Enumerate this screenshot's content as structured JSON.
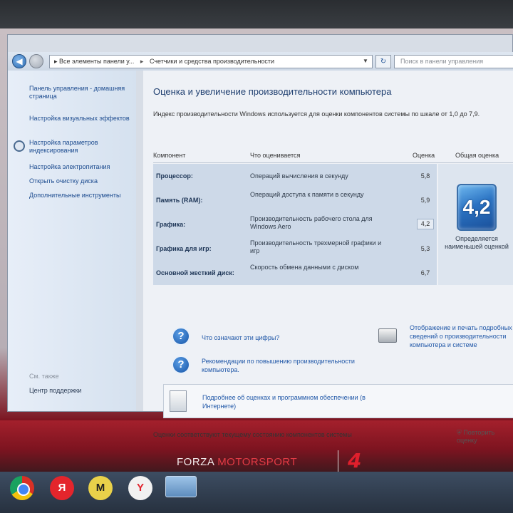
{
  "window": {
    "breadcrumb": [
      "Все элементы панели у...",
      "Счетчики и средства производительности"
    ],
    "search_placeholder": "Поиск в панели управления"
  },
  "sidebar": {
    "links": [
      {
        "label": "Панель управления - домашняя страница"
      },
      {
        "label": "Настройка визуальных эффектов"
      },
      {
        "label": "Настройка параметров индексирования"
      },
      {
        "label": "Настройка электропитания"
      },
      {
        "label": "Открыть очистку диска"
      },
      {
        "label": "Дополнительные инструменты"
      }
    ],
    "see_also": "См. также",
    "support_center": "Центр поддержки"
  },
  "main": {
    "title": "Оценка и увеличение производительности компьютера",
    "description": "Индекс производительности Windows используется для оценки компонентов системы по шкале от 1,0 до 7,9.",
    "table": {
      "headers": {
        "component": "Компонент",
        "what": "Что оценивается",
        "score": "Оценка",
        "overall": "Общая оценка"
      },
      "rows": [
        {
          "component": "Процессор:",
          "what": "Операций вычисления в секунду",
          "score": "5,8"
        },
        {
          "component": "Память (RAM):",
          "what": "Операций доступа к памяти в секунду",
          "score": "5,9"
        },
        {
          "component": "Графика:",
          "what": "Производительность рабочего стола для Windows Aero",
          "score": "4,2"
        },
        {
          "component": "Графика для игр:",
          "what": "Производительность трехмерной графики и игр",
          "score": "5,3"
        },
        {
          "component": "Основной жесткий диск:",
          "what": "Скорость обмена данными с диском",
          "score": "6,7"
        }
      ],
      "overall_score": "4,2",
      "overall_note": "Определяется наименьшей оценкой"
    },
    "links": {
      "what_numbers": "Что означают эти цифры?",
      "recommendations": "Рекомендации по повышению производительности компьютера.",
      "print_details": "Отображение и печать подробных сведений о производительности компьютера и системе",
      "more_info": "Подробнее об оценках и программном обеспечении (в Интернете)"
    },
    "footer": "Оценки соответствуют текущему состоянию компонентов системы",
    "repeat_label": "Повторить оценку"
  },
  "desktop": {
    "brand_forza": "FORZA",
    "brand_motorsport": "MOTORSPORT",
    "brand_number": "4"
  },
  "taskbar": {
    "yandex_letter": "Я",
    "m_letter": "M",
    "y_letter": "Y"
  }
}
